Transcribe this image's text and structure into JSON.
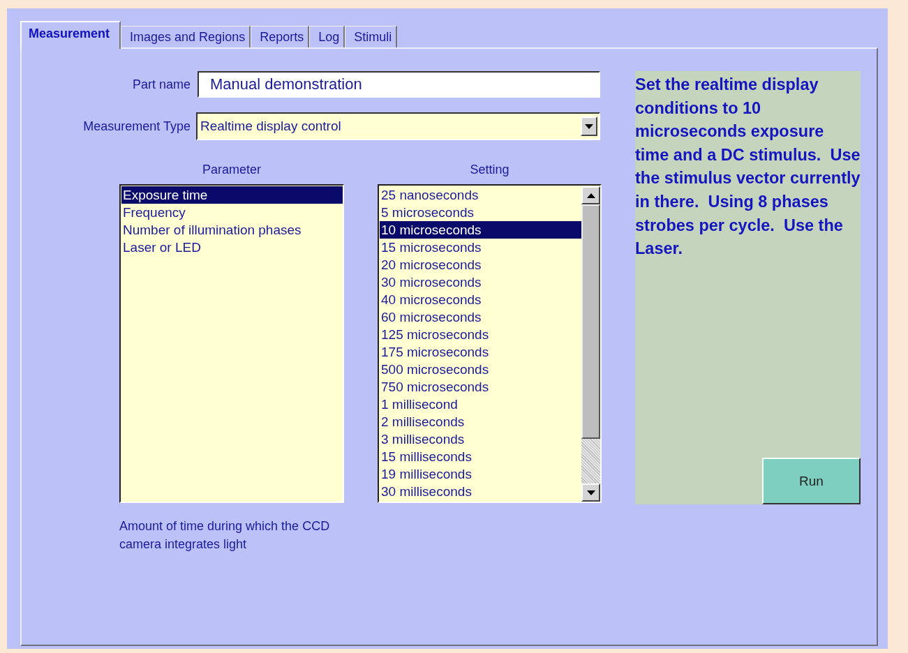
{
  "tabs": [
    {
      "label": "Measurement",
      "selected": true
    },
    {
      "label": "Images and Regions",
      "selected": false
    },
    {
      "label": "Reports",
      "selected": false
    },
    {
      "label": "Log",
      "selected": false
    },
    {
      "label": "Stimuli",
      "selected": false
    }
  ],
  "part_name": {
    "label": "Part name",
    "value": "Manual demonstration"
  },
  "measurement_type": {
    "label": "Measurement Type",
    "value": "Realtime display control"
  },
  "parameter_list": {
    "heading": "Parameter",
    "items": [
      {
        "label": "Exposure time",
        "selected": true
      },
      {
        "label": "Frequency",
        "selected": false
      },
      {
        "label": "Number of illumination phases",
        "selected": false
      },
      {
        "label": "Laser or LED",
        "selected": false
      }
    ]
  },
  "setting_list": {
    "heading": "Setting",
    "items": [
      {
        "label": "25 nanoseconds",
        "selected": false
      },
      {
        "label": "5 microseconds",
        "selected": false
      },
      {
        "label": "10 microseconds",
        "selected": true
      },
      {
        "label": "15 microseconds",
        "selected": false
      },
      {
        "label": "20 microseconds",
        "selected": false
      },
      {
        "label": "30 microseconds",
        "selected": false
      },
      {
        "label": "40 microseconds",
        "selected": false
      },
      {
        "label": "60 microseconds",
        "selected": false
      },
      {
        "label": "125 microseconds",
        "selected": false
      },
      {
        "label": "175 microseconds",
        "selected": false
      },
      {
        "label": "500 microseconds",
        "selected": false
      },
      {
        "label": "750 microseconds",
        "selected": false
      },
      {
        "label": "1 millisecond",
        "selected": false
      },
      {
        "label": "2 milliseconds",
        "selected": false
      },
      {
        "label": "3 milliseconds",
        "selected": false
      },
      {
        "label": "15 milliseconds",
        "selected": false
      },
      {
        "label": "19 milliseconds",
        "selected": false
      },
      {
        "label": "30 milliseconds",
        "selected": false
      }
    ]
  },
  "parameter_description": "Amount of time during which the CCD camera integrates light",
  "instructions": "Set the realtime display conditions to 10 microseconds exposure time and a DC stimulus.  Use the stimulus vector currently in there.  Using 8 phases strobes per cycle.  Use the Laser.",
  "run_button": "Run"
}
